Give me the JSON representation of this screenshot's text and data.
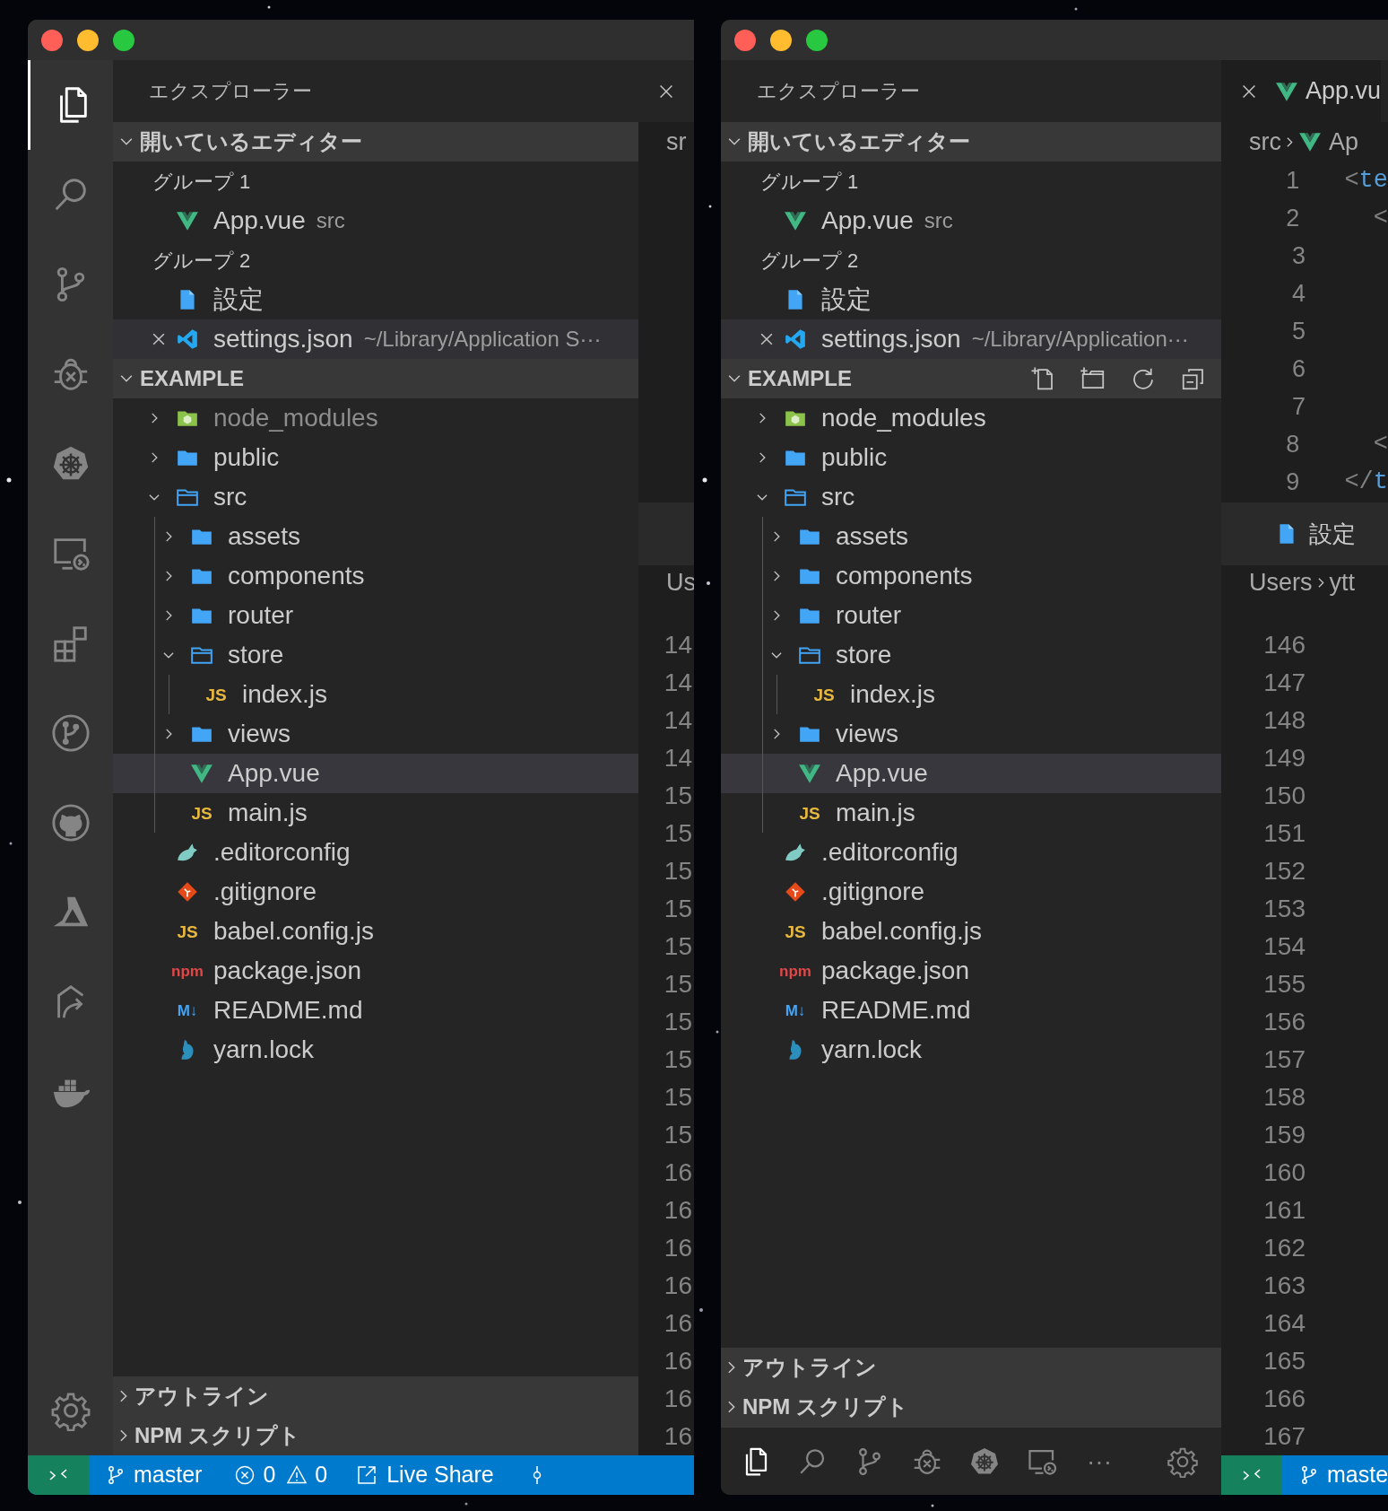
{
  "windows": [
    {
      "explorer_title": "エクスプローラー",
      "open_editors": {
        "label": "開いているエディター",
        "expanded": true,
        "groups": [
          {
            "label": "グループ 1",
            "files": [
              {
                "name": "App.vue",
                "detail": "src",
                "kind": "vue",
                "selected": false
              }
            ]
          },
          {
            "label": "グループ 2",
            "files": [
              {
                "name": "設定",
                "kind": "file",
                "selected": false
              },
              {
                "name": "settings.json",
                "detail": "~/Library/Application S···",
                "kind": "vscode",
                "selected": true
              }
            ]
          }
        ]
      },
      "folder": {
        "label": "EXAMPLE",
        "expanded": true,
        "actions_visible": false,
        "items": [
          {
            "name": "node_modules",
            "kind": "node-folder",
            "expanded": false,
            "dimmed": true,
            "selected": false
          },
          {
            "name": "public",
            "kind": "folder",
            "expanded": false,
            "dimmed": false,
            "selected": false
          },
          {
            "name": "src",
            "kind": "folder",
            "expanded": true,
            "dimmed": false,
            "selected": false,
            "children": [
              {
                "name": "assets",
                "kind": "folder",
                "expanded": false,
                "dimmed": false,
                "selected": false
              },
              {
                "name": "components",
                "kind": "folder",
                "expanded": false,
                "dimmed": false,
                "selected": false
              },
              {
                "name": "router",
                "kind": "folder",
                "expanded": false,
                "dimmed": false,
                "selected": false
              },
              {
                "name": "store",
                "kind": "folder",
                "expanded": true,
                "dimmed": false,
                "selected": false,
                "children": [
                  {
                    "name": "index.js",
                    "kind": "js",
                    "icon_label": "JS",
                    "dimmed": false,
                    "selected": false
                  }
                ]
              },
              {
                "name": "views",
                "kind": "folder",
                "expanded": false,
                "dimmed": false,
                "selected": false
              },
              {
                "name": "App.vue",
                "kind": "vue",
                "dimmed": false,
                "selected": true
              },
              {
                "name": "main.js",
                "kind": "js",
                "icon_label": "JS",
                "dimmed": false,
                "selected": false
              }
            ]
          },
          {
            "name": ".editorconfig",
            "kind": "editorconfig",
            "dimmed": false,
            "selected": false
          },
          {
            "name": ".gitignore",
            "kind": "gitignore",
            "dimmed": false,
            "selected": false
          },
          {
            "name": "babel.config.js",
            "kind": "js",
            "icon_label": "JS",
            "dimmed": false,
            "selected": false
          },
          {
            "name": "package.json",
            "kind": "npm",
            "icon_label": "npm",
            "dimmed": false,
            "selected": false
          },
          {
            "name": "README.md",
            "kind": "markdown",
            "icon_label": "M↓",
            "dimmed": false,
            "selected": false
          },
          {
            "name": "yarn.lock",
            "kind": "yarn",
            "dimmed": false,
            "selected": false
          }
        ]
      },
      "outline": {
        "label": "アウトライン",
        "expanded": false
      },
      "npm_scripts": {
        "label": "NPM スクリプト",
        "expanded": false
      },
      "editor": {
        "breadcrumb": [
          {
            "label": "sr"
          }
        ],
        "panel_breadcrumb": [
          {
            "label": "Us"
          }
        ],
        "line_numbers": [
          "14",
          "14",
          "14",
          "14",
          "15",
          "15",
          "15",
          "15",
          "15",
          "15",
          "15",
          "15",
          "15",
          "15",
          "16",
          "16",
          "16",
          "16",
          "16",
          "16",
          "16",
          "16"
        ]
      },
      "activity_bar": {
        "kind": "side",
        "items": [
          {
            "kind": "files",
            "selected": true
          },
          {
            "kind": "search",
            "selected": false
          },
          {
            "kind": "source-control",
            "selected": false
          },
          {
            "kind": "debug",
            "selected": false
          },
          {
            "kind": "kubernetes",
            "selected": false
          },
          {
            "kind": "remote",
            "selected": false
          },
          {
            "kind": "extensions",
            "selected": false
          },
          {
            "kind": "git-graph",
            "selected": false
          },
          {
            "kind": "github",
            "selected": false
          },
          {
            "kind": "azure",
            "selected": false
          },
          {
            "kind": "share",
            "selected": false
          },
          {
            "kind": "docker",
            "selected": false
          }
        ]
      },
      "status_bar": {
        "branch": "master",
        "errors": "0",
        "warnings": "0",
        "live_share": "Live Share",
        "show_commit": true
      }
    },
    {
      "explorer_title": "エクスプローラー",
      "open_editors": {
        "label": "開いているエディター",
        "expanded": true,
        "groups": [
          {
            "label": "グループ 1",
            "files": [
              {
                "name": "App.vue",
                "detail": "src",
                "kind": "vue",
                "selected": false
              }
            ]
          },
          {
            "label": "グループ 2",
            "files": [
              {
                "name": "設定",
                "kind": "file",
                "selected": false
              },
              {
                "name": "settings.json",
                "detail": "~/Library/Application···",
                "kind": "vscode",
                "selected": true
              }
            ]
          }
        ]
      },
      "folder": {
        "label": "EXAMPLE",
        "expanded": true,
        "actions_visible": true,
        "items": [
          {
            "name": "node_modules",
            "kind": "node-folder",
            "expanded": false,
            "dimmed": false,
            "selected": false
          },
          {
            "name": "public",
            "kind": "folder",
            "expanded": false,
            "dimmed": false,
            "selected": false
          },
          {
            "name": "src",
            "kind": "folder",
            "expanded": true,
            "dimmed": false,
            "selected": false,
            "children": [
              {
                "name": "assets",
                "kind": "folder",
                "expanded": false,
                "dimmed": false,
                "selected": false
              },
              {
                "name": "components",
                "kind": "folder",
                "expanded": false,
                "dimmed": false,
                "selected": false
              },
              {
                "name": "router",
                "kind": "folder",
                "expanded": false,
                "dimmed": false,
                "selected": false
              },
              {
                "name": "store",
                "kind": "folder",
                "expanded": true,
                "dimmed": false,
                "selected": false,
                "children": [
                  {
                    "name": "index.js",
                    "kind": "js",
                    "icon_label": "JS",
                    "dimmed": false,
                    "selected": false
                  }
                ]
              },
              {
                "name": "views",
                "kind": "folder",
                "expanded": false,
                "dimmed": false,
                "selected": false
              },
              {
                "name": "App.vue",
                "kind": "vue",
                "dimmed": false,
                "selected": true
              },
              {
                "name": "main.js",
                "kind": "js",
                "icon_label": "JS",
                "dimmed": false,
                "selected": false
              }
            ]
          },
          {
            "name": ".editorconfig",
            "kind": "editorconfig",
            "dimmed": false,
            "selected": false
          },
          {
            "name": ".gitignore",
            "kind": "gitignore",
            "dimmed": false,
            "selected": false
          },
          {
            "name": "babel.config.js",
            "kind": "js",
            "icon_label": "JS",
            "dimmed": false,
            "selected": false
          },
          {
            "name": "package.json",
            "kind": "npm",
            "icon_label": "npm",
            "dimmed": false,
            "selected": false
          },
          {
            "name": "README.md",
            "kind": "markdown",
            "icon_label": "M↓",
            "dimmed": false,
            "selected": false
          },
          {
            "name": "yarn.lock",
            "kind": "yarn",
            "dimmed": false,
            "selected": false
          }
        ]
      },
      "outline": {
        "label": "アウトライン",
        "expanded": false
      },
      "npm_scripts": {
        "label": "NPM スクリプト",
        "expanded": false
      },
      "editor": {
        "tab": {
          "name": "App.vu",
          "kind": "vue"
        },
        "breadcrumb": [
          {
            "label": "src"
          },
          {
            "label": "Ap",
            "kind": "vue"
          }
        ],
        "code_lines": [
          {
            "number": "1",
            "tokens": [
              {
                "text": "<",
                "kind": "punct"
              },
              {
                "text": "te",
                "kind": "tag"
              }
            ]
          },
          {
            "number": "2",
            "tokens": [
              {
                "text": "  <",
                "kind": "punct"
              }
            ]
          },
          {
            "number": "3"
          },
          {
            "number": "4"
          },
          {
            "number": "5"
          },
          {
            "number": "6"
          },
          {
            "number": "7"
          },
          {
            "number": "8",
            "tokens": [
              {
                "text": "  <",
                "kind": "punct"
              }
            ]
          },
          {
            "number": "9",
            "tokens": [
              {
                "text": "</",
                "kind": "punct"
              },
              {
                "text": "t",
                "kind": "tag"
              }
            ]
          }
        ],
        "panel_tab": {
          "name": "設定",
          "kind": "file"
        },
        "panel_breadcrumb": [
          {
            "label": "Users"
          },
          {
            "label": "ytt"
          }
        ],
        "line_numbers": [
          "146",
          "147",
          "148",
          "149",
          "150",
          "151",
          "152",
          "153",
          "154",
          "155",
          "156",
          "157",
          "158",
          "159",
          "160",
          "161",
          "162",
          "163",
          "164",
          "165",
          "166",
          "167"
        ]
      },
      "activity_bar": {
        "kind": "bottom",
        "items": [
          {
            "kind": "files",
            "selected": true
          },
          {
            "kind": "search",
            "selected": false
          },
          {
            "kind": "source-control",
            "selected": false
          },
          {
            "kind": "debug",
            "selected": false
          },
          {
            "kind": "kubernetes",
            "selected": false
          },
          {
            "kind": "remote",
            "selected": false
          },
          {
            "kind": "more",
            "label": "···",
            "selected": false
          }
        ]
      },
      "status_bar": {
        "branch": "maste"
      }
    }
  ]
}
